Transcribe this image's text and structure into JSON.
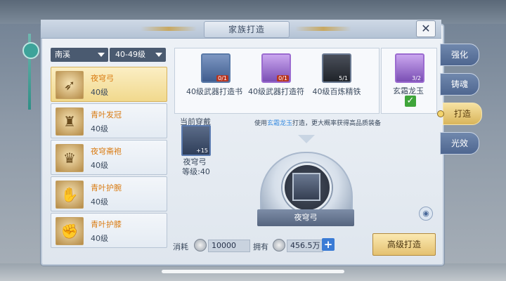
{
  "window": {
    "title": "家族打造"
  },
  "filters": {
    "region": "南溪",
    "level_range": "40-49级"
  },
  "items": [
    {
      "name": "夜穹弓",
      "level": "40级",
      "icon": "bow-icon"
    },
    {
      "name": "青叶发冠",
      "level": "40级",
      "icon": "crown-icon"
    },
    {
      "name": "夜穹斋袍",
      "level": "40级",
      "icon": "robe-icon"
    },
    {
      "name": "青叶护腕",
      "level": "40级",
      "icon": "bracer-icon"
    },
    {
      "name": "青叶护膝",
      "level": "40级",
      "icon": "kneepad-icon"
    }
  ],
  "materials": [
    {
      "name": "40级武器打造书",
      "count": "0/1",
      "icon": "scroll-icon"
    },
    {
      "name": "40级武器打造符",
      "count": "0/1",
      "icon": "talisman-icon"
    },
    {
      "name": "40级百炼精铁",
      "count": "5/1",
      "icon": "iron-ore-icon"
    }
  ],
  "special_material": {
    "name": "玄霜龙玉",
    "count": "3/2",
    "icon": "dragon-jade-icon",
    "checked": true
  },
  "tabs": [
    "强化",
    "铸魂",
    "打造",
    "光效"
  ],
  "active_tab": "打造",
  "current": {
    "label": "当前穿戴",
    "name": "夜穹弓",
    "level": "等级:40",
    "enhance": "+15"
  },
  "hint": {
    "pre": "使用",
    "highlight": "玄霜龙玉",
    "post": "打造，更大概率获得高品质装备"
  },
  "forge_item": {
    "name": "夜穹弓"
  },
  "cost": {
    "label": "消耗",
    "value": "10000"
  },
  "owned": {
    "label": "拥有",
    "value": "456.5万"
  },
  "buttons": {
    "close": "✕",
    "add": "+",
    "forge": "高级打造",
    "eye": "◉"
  },
  "colors": {
    "accent_gold": "#e4c170",
    "highlight_blue": "#3a8de0",
    "item_name_orange": "#d97b12"
  }
}
